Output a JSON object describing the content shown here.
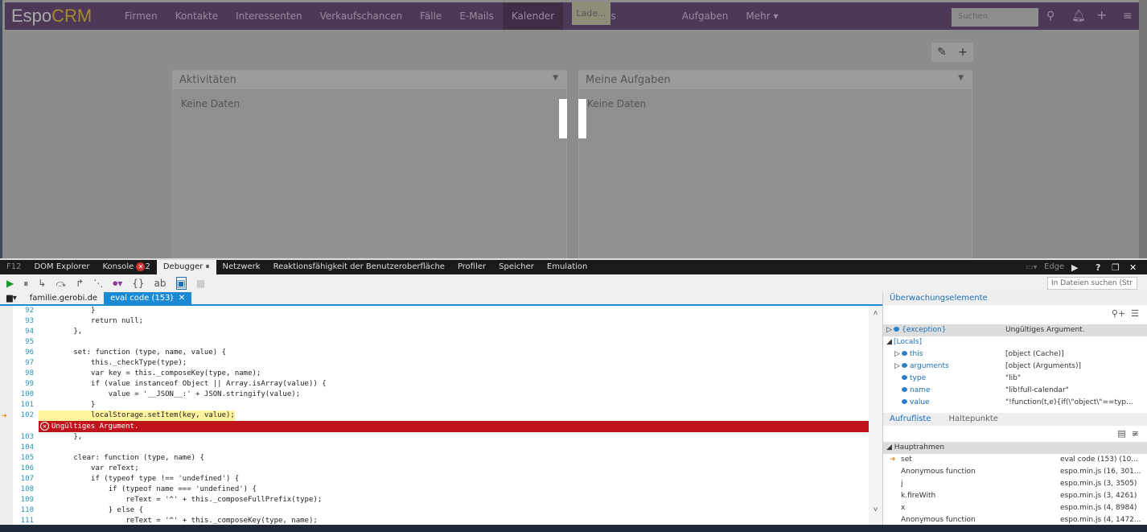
{
  "app": {
    "logo": "EspoCRM",
    "logo_a": "Espo",
    "logo_b": "CRM",
    "nav": [
      "Firmen",
      "Kontakte",
      "Interessenten",
      "Verkaufschancen",
      "Fälle",
      "E-Mails",
      "Kalender",
      "Meetings",
      "Aufgaben",
      "Mehr ▾"
    ],
    "active_nav": "Kalender",
    "loading": "Lade...",
    "search_placeholder": "Suchen",
    "panels": [
      {
        "title": "Aktivitäten",
        "body": "Keine Daten"
      },
      {
        "title": "Meine Aufgaben",
        "body": "Keine Daten"
      }
    ]
  },
  "devtools": {
    "tabs": [
      "F12",
      "DOM Explorer",
      "Konsole",
      "Debugger",
      "Netzwerk",
      "Reaktionsfähigkeit der Benutzeroberfläche",
      "Profiler",
      "Speicher",
      "Emulation"
    ],
    "console_errors": "2",
    "mode": "Edge",
    "file_search_placeholder": "In Dateien suchen (Str",
    "file_tabs": [
      "familie.gerobi.de",
      "eval code (153)"
    ],
    "code": [
      {
        "n": "92",
        "t": "            }"
      },
      {
        "n": "93",
        "t": "            return null;"
      },
      {
        "n": "94",
        "t": "        },"
      },
      {
        "n": "95",
        "t": ""
      },
      {
        "n": "96",
        "t": "        set: function (type, name, value) {"
      },
      {
        "n": "97",
        "t": "            this._checkType(type);"
      },
      {
        "n": "98",
        "t": "            var key = this._composeKey(type, name);"
      },
      {
        "n": "99",
        "t": "            if (value instanceof Object || Array.isArray(value)) {"
      },
      {
        "n": "100",
        "t": "                value = '__JSON__:' + JSON.stringify(value);"
      },
      {
        "n": "101",
        "t": "            }"
      },
      {
        "n": "102",
        "t": "            localStorage.setItem(key, value);"
      },
      {
        "n": "103",
        "t": "        },"
      },
      {
        "n": "104",
        "t": ""
      },
      {
        "n": "105",
        "t": "        clear: function (type, name) {"
      },
      {
        "n": "106",
        "t": "            var reText;"
      },
      {
        "n": "107",
        "t": "            if (typeof type !== 'undefined') {"
      },
      {
        "n": "108",
        "t": "                if (typeof name === 'undefined') {"
      },
      {
        "n": "109",
        "t": "                    reText = '^' + this._composeFullPrefix(type);"
      },
      {
        "n": "110",
        "t": "                } else {"
      },
      {
        "n": "111",
        "t": "                    reText = '^' + this._composeKey(type, name);"
      }
    ],
    "error_message": "Ungültiges Argument.",
    "watch": {
      "title": "Überwachungselemente",
      "rows": [
        {
          "k": "{exception}",
          "v": "Ungültiges Argument.",
          "lvl": 0,
          "exp": "▷"
        },
        {
          "k": "[Locals]",
          "v": "",
          "lvl": 0,
          "exp": "◢"
        },
        {
          "k": "this",
          "v": "[object (Cache)]",
          "lvl": 1,
          "exp": "▷"
        },
        {
          "k": "arguments",
          "v": "[object (Arguments)]",
          "lvl": 1,
          "exp": "▷"
        },
        {
          "k": "type",
          "v": "\"lib\"",
          "lvl": 1,
          "exp": ""
        },
        {
          "k": "name",
          "v": "\"lib!full-calendar\"",
          "lvl": 1,
          "exp": ""
        },
        {
          "k": "value",
          "v": "\"!function(t,e){if(\\\"object\\\"==typ...",
          "lvl": 1,
          "exp": ""
        }
      ]
    },
    "callstack": {
      "tabs": [
        "Aufrufliste",
        "Haltepunkte"
      ],
      "group": "Hauptrahmen",
      "rows": [
        {
          "k": "set",
          "v": "eval code (153) (10..."
        },
        {
          "k": "Anonymous function",
          "v": "espo.min.js (16, 301..."
        },
        {
          "k": "j",
          "v": "espo.min.js (3, 3505)"
        },
        {
          "k": "k.fireWith",
          "v": "espo.min.js (3, 4261)"
        },
        {
          "k": "x",
          "v": "espo.min.js (4, 8984)"
        },
        {
          "k": "Anonymous function",
          "v": "espo.min.js (4, 1472..."
        }
      ]
    }
  }
}
